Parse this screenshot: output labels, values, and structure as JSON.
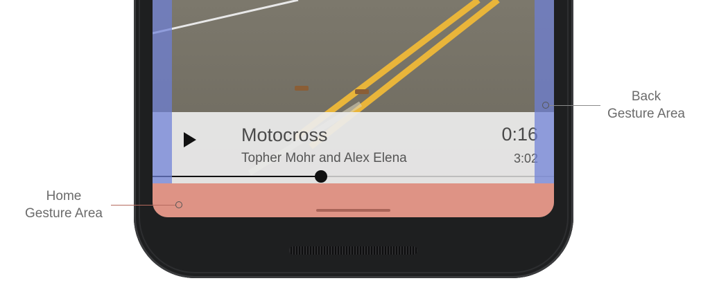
{
  "media": {
    "title": "Motocross",
    "artist": "Topher Mohr and Alex Elena",
    "elapsed": "0:16",
    "duration": "3:02",
    "progress": 0.42,
    "play_icon": "play-icon"
  },
  "annotations": {
    "back": {
      "line1": "Back",
      "line2": "Gesture Area"
    },
    "home": {
      "line1": "Home",
      "line2": "Gesture Area"
    }
  },
  "colors": {
    "back_gesture_overlay": "#6e80d7",
    "home_gesture_overlay": "#de9385",
    "phone_frame": "#1e1f20",
    "road_line": "#f1c43a"
  }
}
